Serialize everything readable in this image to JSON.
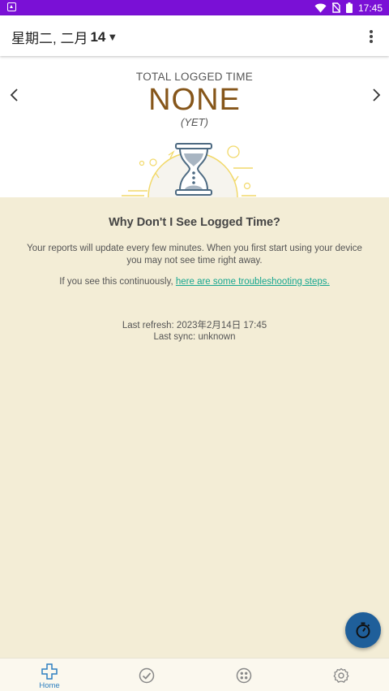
{
  "status_bar": {
    "time": "17:45"
  },
  "header": {
    "date_prefix": "星期二, 二月",
    "date_day": "14",
    "caret": "▼"
  },
  "summary": {
    "label": "TOTAL LOGGED TIME",
    "value": "NONE",
    "sub": "(YET)"
  },
  "info": {
    "title": "Why Don't I See Logged Time?",
    "body": "Your reports will update every few minutes. When you first start using your device you may not see time right away.",
    "link_prefix": "If you see this continuously, ",
    "link_text": "here are some troubleshooting steps.",
    "last_refresh": "Last refresh: 2023年2月14日 17:45",
    "last_sync": "Last sync: unknown"
  },
  "bottom_nav": {
    "home_label": "Home"
  },
  "colors": {
    "status_bar": "#7a10d6",
    "accent_brown": "#86561a",
    "info_bg": "#f3edd6",
    "link": "#16a68f",
    "fab": "#1f5f9a",
    "nav_active": "#2d7fc0"
  },
  "icons": [
    "keyboard-icon",
    "wifi-icon",
    "no-sim-icon",
    "battery-icon",
    "chevron-left-icon",
    "chevron-right-icon",
    "hourglass-icon",
    "stopwatch-icon",
    "home-icon",
    "check-circle-icon",
    "apps-icon",
    "settings-icon"
  ]
}
